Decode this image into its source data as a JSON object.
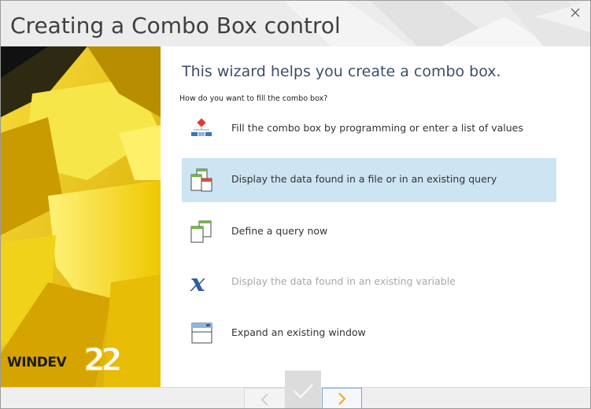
{
  "window": {
    "title": "Creating a Combo Box control"
  },
  "brand": {
    "logo_text": "WINDEV",
    "version": "22"
  },
  "wizard": {
    "headline": "This wizard helps you create a combo box.",
    "question": "How do you want to fill the combo box?",
    "options": [
      {
        "label": "Fill the combo box by programming or enter a list of values",
        "icon": "list-values-icon",
        "selected": false,
        "enabled": true
      },
      {
        "label": "Display the data found in a file or in an existing query",
        "icon": "file-query-icon",
        "selected": true,
        "enabled": true
      },
      {
        "label": "Define a query now",
        "icon": "define-query-icon",
        "selected": false,
        "enabled": true
      },
      {
        "label": "Display the data found in an existing variable",
        "icon": "variable-icon",
        "selected": false,
        "enabled": false
      },
      {
        "label": "Expand an existing window",
        "icon": "window-icon",
        "selected": false,
        "enabled": true
      }
    ]
  },
  "footer": {
    "buttons": [
      {
        "icon": "chevron-left-icon",
        "enabled": false
      },
      {
        "icon": "check-icon",
        "enabled": false
      },
      {
        "icon": "chevron-right-icon",
        "enabled": true
      }
    ]
  },
  "colors": {
    "accent_orange": "#f5a623",
    "selection": "#cde4f3",
    "headline": "#3c4f6b",
    "sidebar_yellow": "#e7c300"
  }
}
